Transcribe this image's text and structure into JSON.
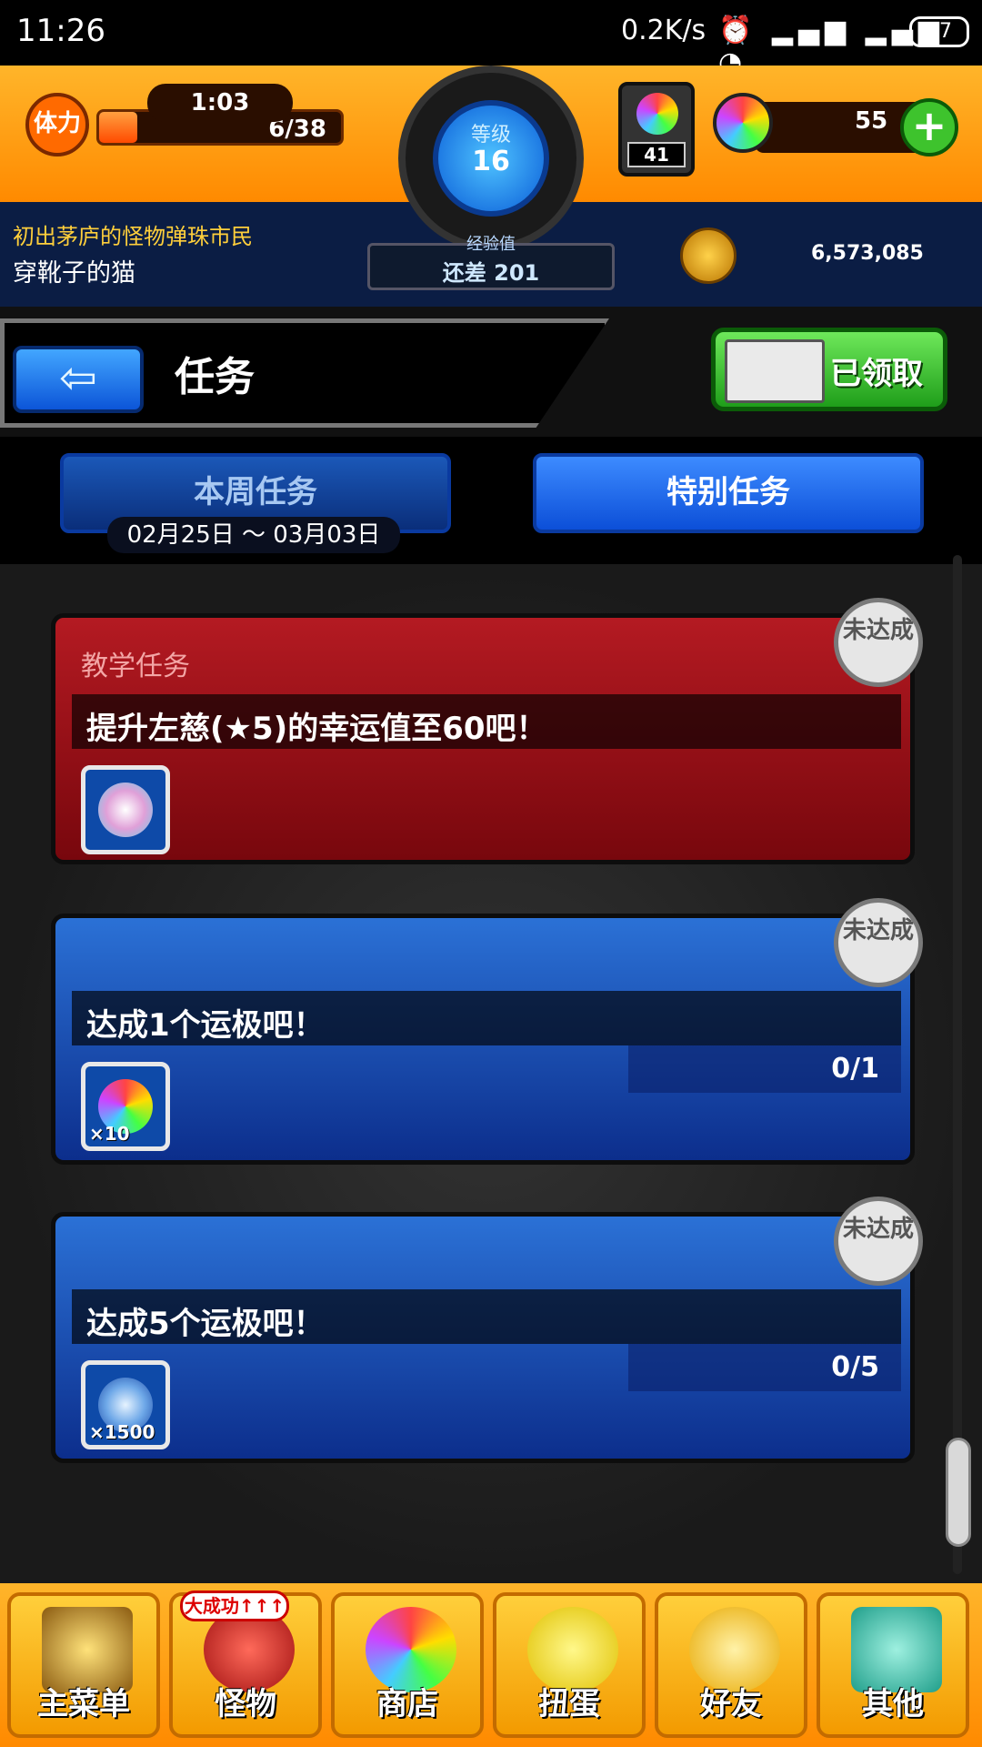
{
  "status_bar": {
    "time": "11:26",
    "network_speed": "0.2K/s",
    "icons": "⏰ ▂▄▆ ▂▄▆ ◔",
    "battery": "47"
  },
  "header": {
    "stamina": {
      "icon_label": "体力",
      "timer": "1:03",
      "count": "6/38",
      "fill_fraction": 0.158
    },
    "level": {
      "label": "等级",
      "value": "16"
    },
    "experience": {
      "label": "经验值",
      "remaining": "还差 201"
    },
    "gems": {
      "count": "41"
    },
    "orbs": {
      "count": "55",
      "add_symbol": "+"
    },
    "player": {
      "title": "初出茅庐的怪物弹珠市民",
      "name": "穿靴子的猫"
    },
    "coins": {
      "count": "6,573,085"
    }
  },
  "title_row": {
    "back_arrow": "⇦",
    "page_title": "任务",
    "claimed_label": "已领取"
  },
  "tabs": {
    "weekly": {
      "label": "本周任务",
      "date_range": "02月25日 ～ 03月03日"
    },
    "special": {
      "label": "特别任务"
    }
  },
  "missions": [
    {
      "category": "教学任务",
      "text": "提升左慈(★5)的幸运值至60吧！",
      "status_badge": "未达成",
      "reward_qty": "",
      "progress": ""
    },
    {
      "category": "",
      "text": "达成1个运极吧！",
      "status_badge": "未达成",
      "reward_qty": "×10",
      "progress": "0/1"
    },
    {
      "category": "",
      "text": "达成5个运极吧！",
      "status_badge": "未达成",
      "reward_qty": "×1500",
      "progress": "0/5"
    }
  ],
  "bottom_nav": {
    "main_menu": "主菜单",
    "monster": "怪物",
    "monster_badge": "大成功↑↑↑",
    "shop": "商店",
    "gacha": "扭蛋",
    "friends": "好友",
    "other": "其他"
  },
  "colors": {
    "orange": "#ff8a00",
    "blue_mission": "#2b71d6",
    "red_mission": "#b41a22",
    "green_button": "#3ec32d"
  }
}
